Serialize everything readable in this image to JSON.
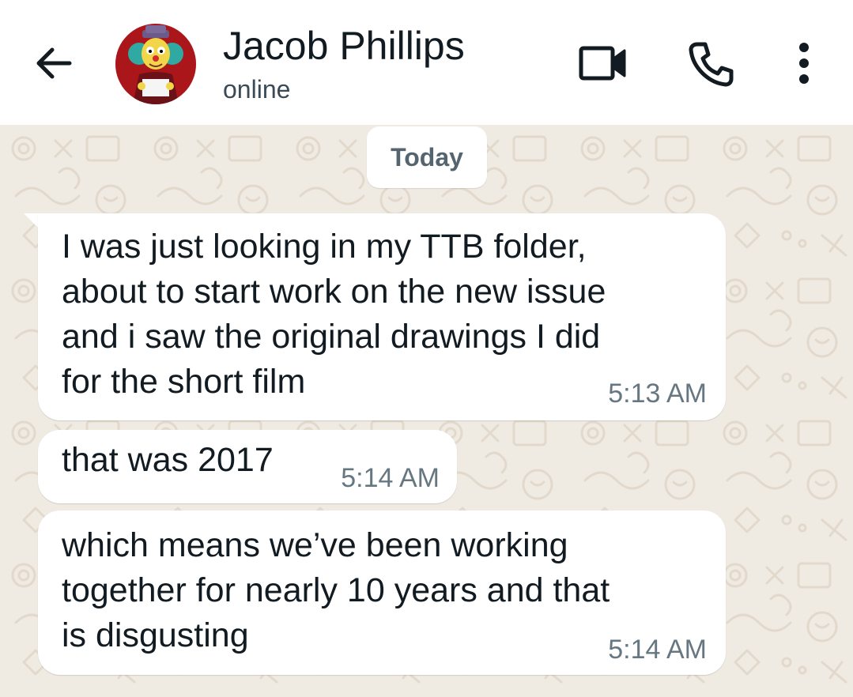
{
  "header": {
    "contact_name": "Jacob Phillips",
    "status": "online",
    "icons": {
      "back": "arrow-left-icon",
      "video": "video-camera-icon",
      "call": "phone-icon",
      "menu": "more-vertical-icon"
    }
  },
  "chat": {
    "date_chip": "Today",
    "messages": [
      {
        "text": "I was just looking in my TTB folder,\nabout to start work on the new issue\nand i saw the original drawings I did\nfor the short film",
        "time": "5:13 AM",
        "direction": "incoming"
      },
      {
        "text": "that was 2017",
        "time": "5:14 AM",
        "direction": "incoming"
      },
      {
        "text": "which means we’ve been working\ntogether for nearly 10 years and that\nis disgusting",
        "time": "5:14 AM",
        "direction": "incoming"
      }
    ]
  },
  "colors": {
    "header_bg": "#ffffff",
    "chat_bg": "#efeae2",
    "bubble_bg": "#ffffff",
    "text": "#111b21",
    "meta_text": "#667781"
  }
}
